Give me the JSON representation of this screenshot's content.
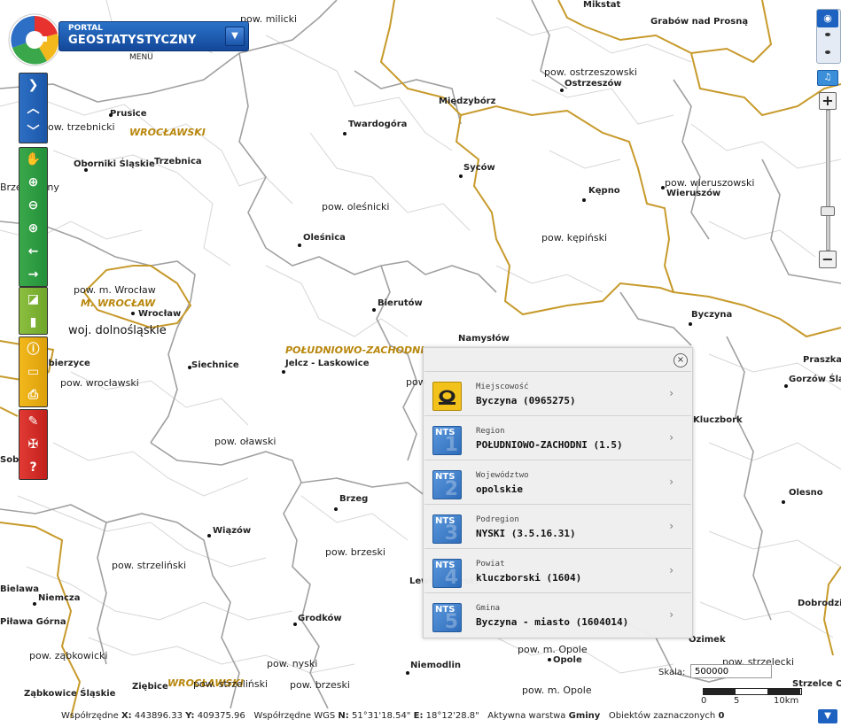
{
  "header": {
    "portal_small": "PORTAL",
    "portal_big": "GEOSTATYSTYCZNY",
    "menu_label": "MENU"
  },
  "map_labels": {
    "pow_milicki": "pow. milicki",
    "mikstat": "Mikstat",
    "grabow": "Grabów nad Prosną",
    "pow_ostrzeszowski": "pow. ostrzeszowski",
    "ostrzeszow": "Ostrzeszów",
    "miedzyborz": "Międzybórz",
    "prusice": "Prusice",
    "pow_trzebnicki": "pow. trzebnicki",
    "wroclawski_reg": "WROCŁAWSKI",
    "twardogora": "Twardogóra",
    "oborniki": "Oborniki Śląskie",
    "trzebnica": "Trzebnica",
    "sycow": "Syców",
    "pow_wieruszowski": "pow. wieruszowski",
    "wieruszow": "Wieruszów",
    "kepno": "Kępno",
    "brzeg_dolny": "Brzeg Dolny",
    "pow_olesnicki": "pow. oleśnicki",
    "pow_kepinski": "pow. kępiński",
    "olesnica": "Oleśnica",
    "pow_m_wroclaw": "pow. m. Wrocław",
    "m_wroclaw": "M. WROCŁAW",
    "wroclaw": "Wrocław",
    "bierutow": "Bierutów",
    "byczyna": "Byczyna",
    "woj_dolnoslaskie": "woj. dolnośląskie",
    "namyslow": "Namysłów",
    "poludniowo": "POŁUDNIOWO-ZACHODNI",
    "kobierzyce": "Kobierzyce",
    "siechnice": "Siechnice",
    "jelcz": "Jelcz - Laskowice",
    "pow_wroclawski": "pow. wrocławski",
    "pow_trunc": "pow",
    "praszka": "Praszka",
    "gorzow": "Gorzów Śląski",
    "kluczbork": "Kluczbork",
    "pow_olawski": "pow. oławski",
    "sobotka": "Sobótka",
    "brzeg": "Brzeg",
    "olesno": "Olesno",
    "wiazow": "Wiązów",
    "pow_brzeski": "pow. brzeski",
    "pow_strzelinski": "pow. strzeliński",
    "lewin": "Lewin Brzeski",
    "bielawa": "Bielawa",
    "niemcza": "Niemcza",
    "pilawa": "Piława Górna",
    "grodkow": "Grodków",
    "dobrodzien": "Dobrodzień",
    "ozimek": "Ozimek",
    "pow_zabkowicki": "pow. ząbkowicki",
    "pow_nyski": "pow. nyski",
    "pow_m_opole": "pow. m. Opole",
    "opole": "Opole",
    "pow_strzelecki": "pow. strzelecki",
    "niemodlin": "Niemodlin",
    "zabkowice": "Ząbkowice Śląskie",
    "ziebice": "Ziębice",
    "wroclawski2": "WROCŁAWSKI",
    "pow_strzelinski2": "pow. strzeliński",
    "pow_brzeski2": "pow. brzeski",
    "pow_opolski": "pow. m. Opole",
    "strzelce": "Strzelce Op."
  },
  "popup": {
    "rows": [
      {
        "title": "Miejscowość",
        "value": "Byczyna (0965275)",
        "icon": "locality-icon"
      },
      {
        "title": "Region",
        "value": "POŁUDNIOWO-ZACHODNI (1.5)",
        "icon": "nts1-icon",
        "nts": "NTS",
        "num": "1"
      },
      {
        "title": "Województwo",
        "value": "opolskie",
        "icon": "nts2-icon",
        "nts": "NTS",
        "num": "2"
      },
      {
        "title": "Podregion",
        "value": "NYSKI (3.5.16.31)",
        "icon": "nts3-icon",
        "nts": "NTS",
        "num": "3"
      },
      {
        "title": "Powiat",
        "value": "kluczborski (1604)",
        "icon": "nts4-icon",
        "nts": "NTS",
        "num": "4"
      },
      {
        "title": "Gmina",
        "value": "Byczyna - miasto (1604014)",
        "icon": "nts5-icon",
        "nts": "NTS",
        "num": "5"
      }
    ]
  },
  "scale": {
    "label": "Skala:",
    "value": "500000",
    "ticks": [
      "0",
      "5",
      "10km"
    ]
  },
  "status": {
    "coords_label": "Współrzędne",
    "x_label": "X:",
    "x_value": "443896.33",
    "y_label": "Y:",
    "y_value": "409375.96",
    "wgs_label": "Współrzędne WGS",
    "n_label": "N:",
    "n_value": "51°31'18.54\"",
    "e_label": "E:",
    "e_value": "18°12'28.8\"",
    "layer_label": "Aktywna warstwa",
    "layer_value": "Gminy",
    "selected_label": "Obiektów zaznaczonych",
    "selected_value": "0"
  },
  "colors": {
    "region_border": "#c89b2a",
    "powiat_border": "#9b9b9b",
    "gmina_border": "#cfcfcf"
  }
}
